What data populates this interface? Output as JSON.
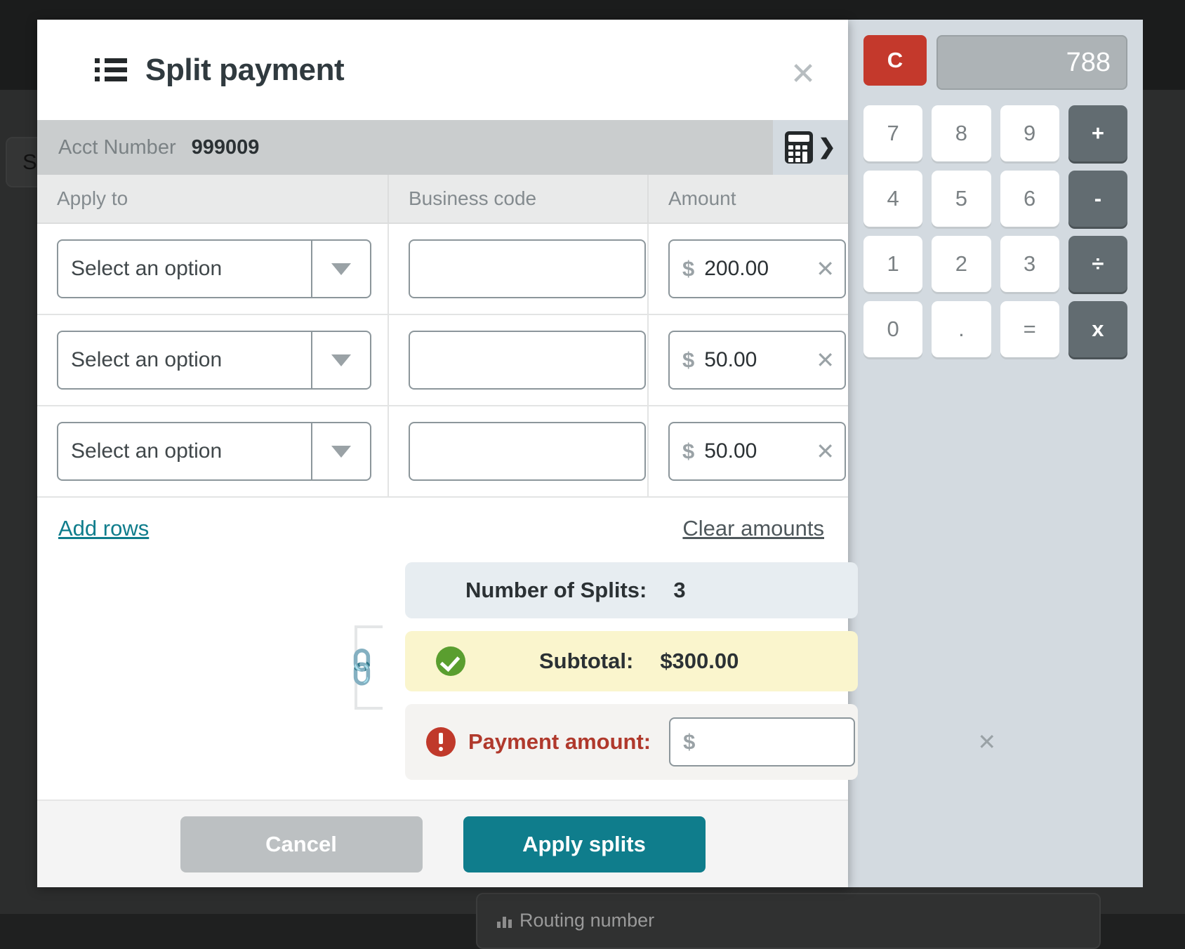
{
  "background": {
    "sidebar_button_label": "Si",
    "bottom_card_label": "Routing number"
  },
  "modal": {
    "title": "Split payment",
    "menu_icon": "list-icon",
    "close_icon": "close-icon",
    "acct": {
      "label": "Acct Number",
      "value": "999009"
    },
    "calc_toggle_icon": "calculator-icon",
    "table": {
      "headers": [
        "Apply to",
        "Business code",
        "Amount"
      ],
      "rows": [
        {
          "apply_to": "Select an option",
          "business_code": "",
          "business_code_placeholder": "",
          "currency": "$",
          "amount": "200.00"
        },
        {
          "apply_to": "Select an option",
          "business_code": "",
          "business_code_placeholder": "",
          "currency": "$",
          "amount": "50.00"
        },
        {
          "apply_to": "Select an option",
          "business_code": "",
          "business_code_placeholder": "",
          "currency": "$",
          "amount": "50.00"
        }
      ]
    },
    "links": {
      "add_rows": "Add rows",
      "clear_amounts": "Clear amounts"
    },
    "summary": {
      "splits_label": "Number of Splits:",
      "splits_value": "3",
      "subtotal_label": "Subtotal:",
      "subtotal_value": "$300.00",
      "subtotal_status_icon": "check-circle-icon",
      "payment_label": "Payment amount:",
      "payment_status_icon": "error-circle-icon",
      "payment_currency": "$",
      "payment_value": "",
      "payment_placeholder": "",
      "link_icon": "chain-link-icon"
    },
    "footer": {
      "cancel_label": "Cancel",
      "apply_label": "Apply splits"
    }
  },
  "calculator": {
    "clear_label": "C",
    "display_value": "788",
    "keys": [
      {
        "label": "7",
        "type": "num"
      },
      {
        "label": "8",
        "type": "num"
      },
      {
        "label": "9",
        "type": "num"
      },
      {
        "label": "+",
        "type": "op"
      },
      {
        "label": "4",
        "type": "num"
      },
      {
        "label": "5",
        "type": "num"
      },
      {
        "label": "6",
        "type": "num"
      },
      {
        "label": "-",
        "type": "op"
      },
      {
        "label": "1",
        "type": "num"
      },
      {
        "label": "2",
        "type": "num"
      },
      {
        "label": "3",
        "type": "num"
      },
      {
        "label": "÷",
        "type": "op"
      },
      {
        "label": "0",
        "type": "num"
      },
      {
        "label": ".",
        "type": "num"
      },
      {
        "label": "=",
        "type": "num"
      },
      {
        "label": "x",
        "type": "op"
      }
    ]
  },
  "colors": {
    "accent_teal": "#0f7d8c",
    "danger_red": "#c4392c",
    "success_green": "#5a9e2f",
    "warning_yellow": "#faf5cd",
    "calc_panel_bg": "#d3dae0"
  }
}
